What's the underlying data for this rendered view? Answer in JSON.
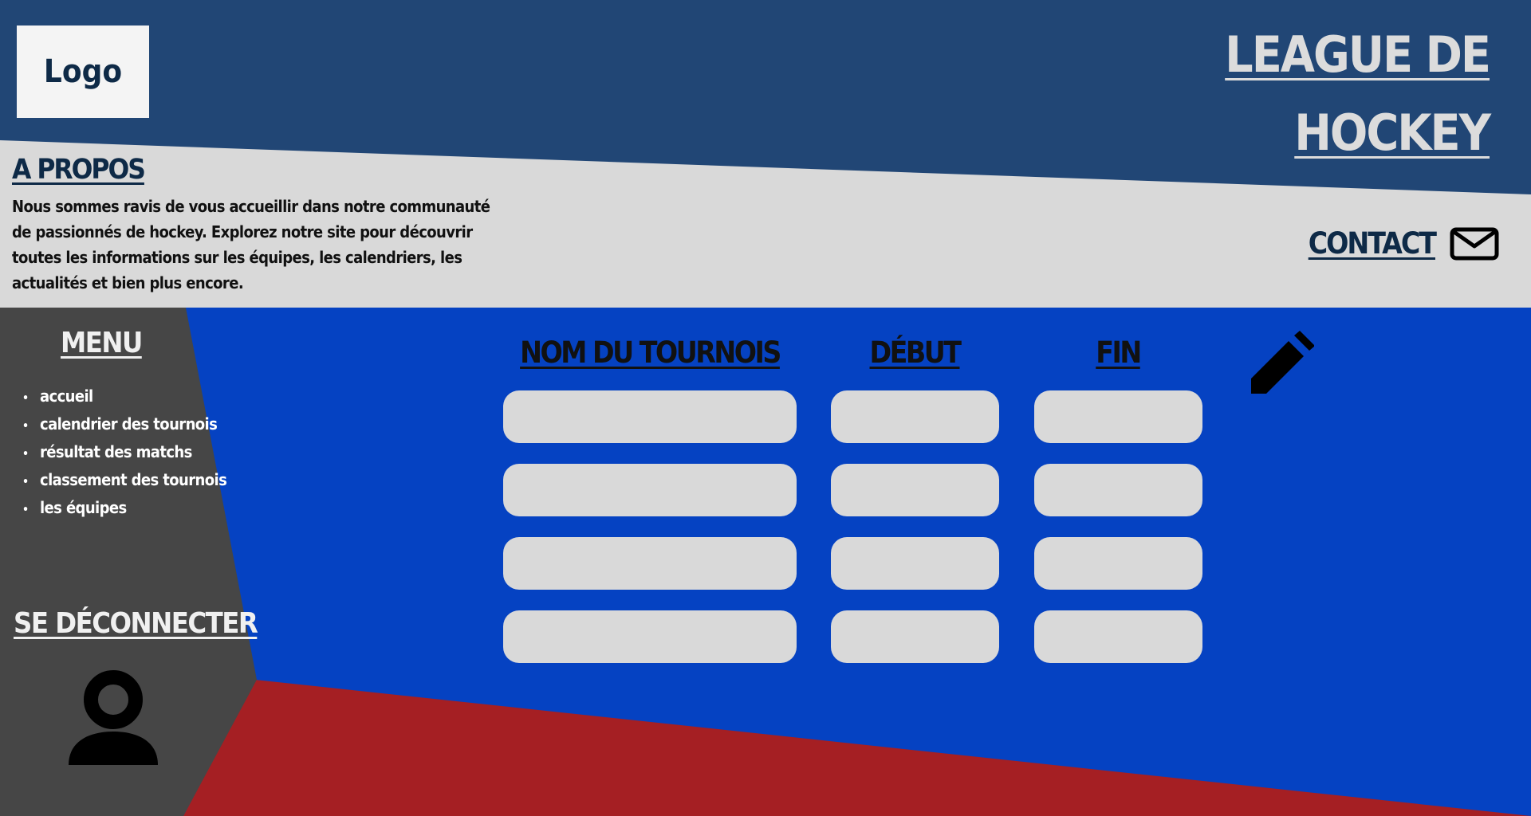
{
  "header": {
    "logo": "Logo",
    "title_line1": "LEAGUE DE",
    "title_line2": "HOCKEY"
  },
  "about": {
    "title": "A PROPOS",
    "text": "Nous sommes ravis de vous accueillir dans notre communauté de passionnés de hockey.  Explorez notre site pour découvrir toutes les informations sur les équipes, les calendriers, les actualités et bien plus encore."
  },
  "contact": {
    "label": "CONTACT",
    "icon": "envelope-icon"
  },
  "sidebar": {
    "title": "MENU",
    "items": [
      {
        "label": "accueil"
      },
      {
        "label": "calendrier des tournois"
      },
      {
        "label": "résultat des matchs"
      },
      {
        "label": "classement des tournois"
      },
      {
        "label": "les équipes"
      }
    ],
    "logout_label": "SE  DÉCONNECTER",
    "user_icon": "user-icon"
  },
  "table": {
    "headers": {
      "name": "NOM DU TOURNOIS",
      "start": "DÉBUT",
      "end": "FIN"
    },
    "rows": [
      {
        "name": "",
        "start": "",
        "end": ""
      },
      {
        "name": "",
        "start": "",
        "end": ""
      },
      {
        "name": "",
        "start": "",
        "end": ""
      },
      {
        "name": "",
        "start": "",
        "end": ""
      }
    ],
    "edit_icon": "pencil-icon"
  },
  "colors": {
    "header_blue": "#214675",
    "light_gray": "#d9d9d9",
    "sidebar_gray": "#464646",
    "content_blue": "#0542c2",
    "accent_red": "#a51f23",
    "text_dark": "#0e2a47"
  }
}
